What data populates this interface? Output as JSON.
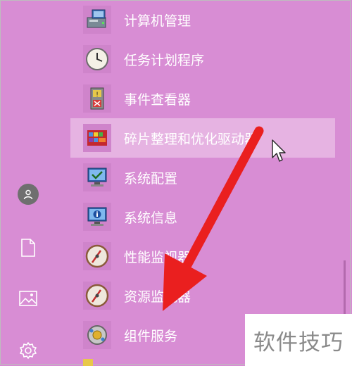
{
  "colors": {
    "background": "#d88dd4",
    "hover": "#e6b3e2",
    "arrow": "#ea1f1f"
  },
  "rail": {
    "user_icon": "user-icon",
    "documents_icon": "document-icon",
    "pictures_icon": "picture-icon",
    "settings_icon": "gear-icon"
  },
  "menu": {
    "items": [
      {
        "label": "计算机管理",
        "icon": "computer-management-icon"
      },
      {
        "label": "任务计划程序",
        "icon": "clock-icon"
      },
      {
        "label": "事件查看器",
        "icon": "event-viewer-icon"
      },
      {
        "label": "碎片整理和优化驱动器",
        "icon": "defrag-icon"
      },
      {
        "label": "系统配置",
        "icon": "system-config-icon"
      },
      {
        "label": "系统信息",
        "icon": "system-info-icon"
      },
      {
        "label": "性能监视器",
        "icon": "gauge-icon"
      },
      {
        "label": "资源监视器",
        "icon": "gauge-icon"
      },
      {
        "label": "组件服务",
        "icon": "component-services-icon"
      }
    ],
    "hovered_index": 3
  },
  "watermark": "软件技巧"
}
